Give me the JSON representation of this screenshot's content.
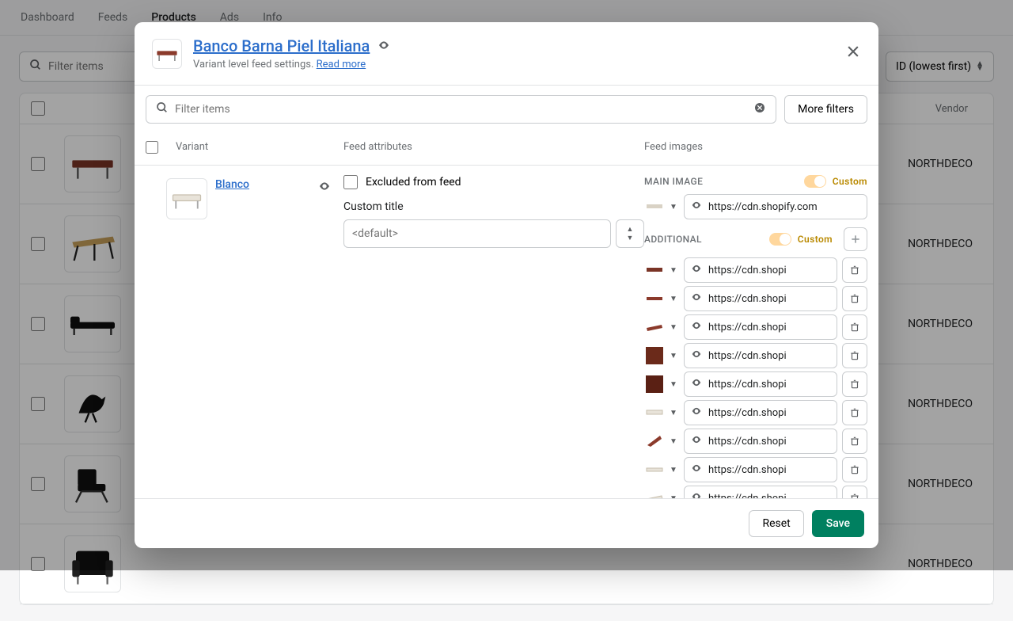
{
  "nav": {
    "items": [
      "Dashboard",
      "Feeds",
      "Products",
      "Ads",
      "Info"
    ],
    "active": "Products"
  },
  "filter": {
    "placeholder": "Filter items",
    "sort": "ID (lowest first)"
  },
  "bg_table": {
    "vendor_col": "Vendor",
    "rows": [
      {
        "vendor": "NORTHDECO",
        "svg": "bench-brown"
      },
      {
        "vendor": "NORTHDECO",
        "svg": "table-wood"
      },
      {
        "vendor": "NORTHDECO",
        "svg": "daybed-black"
      },
      {
        "vendor": "NORTHDECO",
        "svg": "bird-black"
      },
      {
        "vendor": "NORTHDECO",
        "svg": "chair-black"
      },
      {
        "vendor": "NORTHDECO",
        "svg": "armchair-black"
      }
    ]
  },
  "modal": {
    "title": "Banco Barna Piel Italiana",
    "subtitle": "Variant level feed settings.",
    "readmore": "Read more",
    "filter_placeholder": "Filter items",
    "more_filters": "More filters",
    "cols": {
      "variant": "Variant",
      "attrs": "Feed attributes",
      "images": "Feed images"
    },
    "variant": {
      "name": "Blanco",
      "attrs": {
        "excluded_label": "Excluded from feed",
        "title_label": "Custom title",
        "title_placeholder": "<default>"
      },
      "images": {
        "main_label": "MAIN IMAGE",
        "additional_label": "ADDITIONAL",
        "custom_label": "Custom",
        "main_url": "https://cdn.shopify.com",
        "add_urls_short": "https://cdn.shopi",
        "thumbs": [
          "brown-flat",
          "brown-side",
          "brown-angle",
          "leather-1",
          "leather-2",
          "white-flat",
          "corner",
          "white-side",
          "white-angle"
        ]
      }
    },
    "footer": {
      "reset": "Reset",
      "save": "Save"
    }
  }
}
